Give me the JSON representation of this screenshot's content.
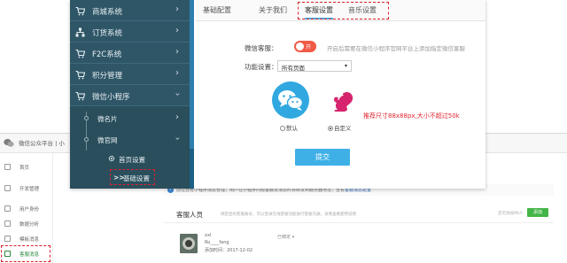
{
  "mp_window": {
    "title": "微信公众平台 | 小",
    "sidebar_items": [
      {
        "label": "首页",
        "icon": "home-icon"
      },
      {
        "label": "开发管理",
        "icon": "code-icon"
      },
      {
        "label": "用户身份",
        "icon": "user-icon"
      },
      {
        "label": "数据分析",
        "icon": "chart-icon"
      },
      {
        "label": "模板消息",
        "icon": "message-icon"
      },
      {
        "label": "客服消息",
        "icon": "service-icon"
      }
    ],
    "notice": {
      "text": "前往自有小程序消息管理，用户在小程序内给客服发消息时将转发到服务器地址，查看",
      "link": "客服消息配置"
    },
    "section_title": "客服人员",
    "section_desc": "绑定后的客服账号，可以登录在线客服功能进行客服沟通，详情查看使用说明",
    "add_note": "还可添加99人",
    "add_button": "添加",
    "agent": {
      "name": "xxl",
      "account": "Ru____fang",
      "date": "添加时间：2017-12-02",
      "status": "已绑定 ▾"
    }
  },
  "app": {
    "sidebar": {
      "items": [
        {
          "label": "商城系统",
          "icon": "cart-icon"
        },
        {
          "label": "订货系统",
          "icon": "org-icon"
        },
        {
          "label": "F2C系统",
          "icon": "cart-icon"
        },
        {
          "label": "积分管理",
          "icon": "cart-icon"
        },
        {
          "label": "微信小程序",
          "icon": "cart-icon"
        }
      ],
      "sub_items": [
        "微名片",
        "微官网"
      ],
      "leaf_items": [
        "首页设置",
        "基础设置"
      ],
      "leaf_prefix": ">>"
    },
    "tabs": [
      "基础配置",
      "关于我们",
      "客服设置",
      "音乐设置"
    ],
    "form": {
      "kefu_label": "微信客服：",
      "toggle_text": "开",
      "kefu_hint": "开启后需要在微信小程序官网平台上添加指定微信客服",
      "func_label": "功能设置：",
      "func_value": "所有页面",
      "radio_default": "默认",
      "radio_custom": "自定义",
      "size_note": "推荐尺寸88x88px,大小不超过50k",
      "submit": "提交"
    }
  },
  "colors": {
    "sidebar_bg": "#2a4e5c",
    "accent_blue": "#3eb0e6",
    "highlight_red": "#d9202b",
    "toggle_red": "#f05a46",
    "wechat_green": "#44b549"
  }
}
